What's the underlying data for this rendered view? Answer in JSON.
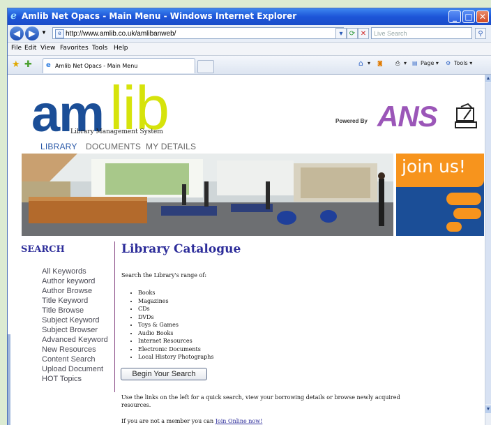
{
  "window": {
    "title": "Amlib Net Opacs - Main Menu - Windows Internet Explorer",
    "minimize": "_",
    "maximize": "□",
    "close": "✕"
  },
  "address": {
    "url": "http://www.amlib.co.uk/amlibanweb/",
    "search_placeholder": "Live Search"
  },
  "menu": [
    "File",
    "Edit",
    "View",
    "Favorites",
    "Tools",
    "Help"
  ],
  "tab": {
    "label": "Amlib Net Opacs - Main Menu"
  },
  "toolbar": {
    "page": "Page",
    "tools": "Tools"
  },
  "site": {
    "logo_am": "am",
    "logo_lib": "lib",
    "logo_sub": "Library Management System",
    "powered_by": "Powered By",
    "ans": "ANS",
    "nav": [
      "LIBRARY",
      "DOCUMENTS",
      "MY DETAILS"
    ],
    "join_us": "join us!"
  },
  "sidebar": {
    "heading": "SEARCH",
    "items": [
      "All Keywords",
      "Author keyword",
      "Author Browse",
      "Title Keyword",
      "Title Browse",
      "Subject Keyword",
      "Subject Browser",
      "Advanced Keyword",
      "New Resources",
      "Content Search",
      "Upload Document",
      "HOT Topics"
    ]
  },
  "main": {
    "heading": "Library Catalogue",
    "intro": "Search the Library's range of:",
    "resources": [
      "Books",
      "Magazines",
      "CDs",
      "DVDs",
      "Toys & Games",
      "Audio Books",
      "Internet Resources",
      "Electronic Documents",
      "Local History Photographs"
    ],
    "button": "Begin Your Search",
    "note": "Use the links on the left for a quick search, view your borrowing details or browse newly acquired resources.",
    "join_prefix": "If you are not a member you can",
    "join_link": "Join Online now!"
  },
  "colors": {
    "brand_blue": "#1b4e97",
    "brand_yellow": "#d6e30b",
    "ans_purple": "#9b56b8",
    "join_orange": "#f7941d",
    "heading_blue": "#2d2d9a"
  }
}
